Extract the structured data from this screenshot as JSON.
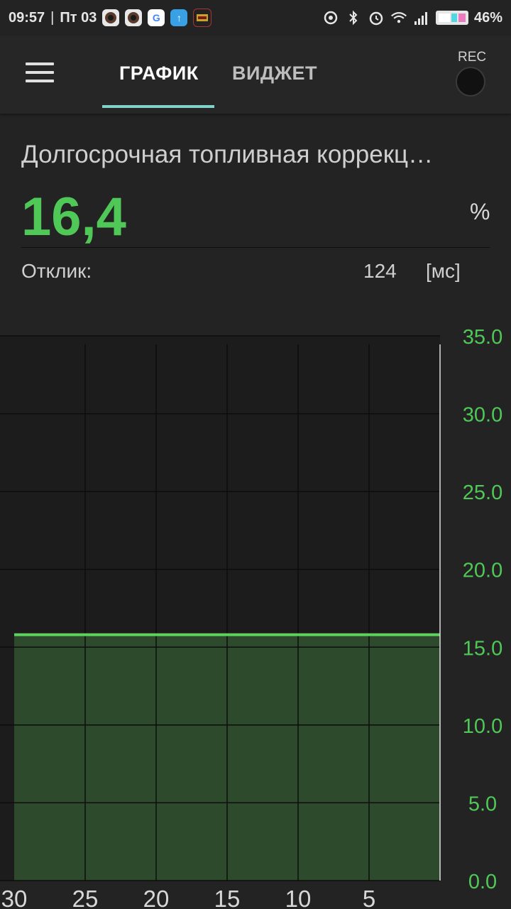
{
  "status_bar": {
    "time": "09:57",
    "date": "Пт 03",
    "battery": "46%"
  },
  "app_bar": {
    "tabs": [
      {
        "label": "ГРАФИК",
        "active": true
      },
      {
        "label": "ВИДЖЕТ",
        "active": false
      }
    ],
    "rec_label": "REC",
    "accent_color": "#7fd3c8"
  },
  "parameter": {
    "name": "Долгосрочная топливная коррекц…",
    "value": "16,4",
    "unit": "%",
    "value_color": "#4fc857"
  },
  "response": {
    "label": "Отклик:",
    "value": "124",
    "unit": "[мс]"
  },
  "chart_data": {
    "type": "area",
    "x": [
      30,
      25,
      20,
      15,
      10,
      5,
      0
    ],
    "values": [
      15.8,
      15.8,
      15.8,
      15.8,
      15.8,
      15.8,
      15.8
    ],
    "x_ticks": [
      "30",
      "25",
      "20",
      "15",
      "10",
      "5"
    ],
    "y_ticks": [
      "0.0",
      "5.0",
      "10.0",
      "15.0",
      "20.0",
      "25.0",
      "30.0",
      "35.0"
    ],
    "xlim": [
      30,
      0
    ],
    "ylim": [
      0,
      35
    ],
    "grid": true,
    "line_color": "#5fcf5f",
    "fill_color": "#2e4a2d",
    "tick_color": "#4fc857"
  }
}
